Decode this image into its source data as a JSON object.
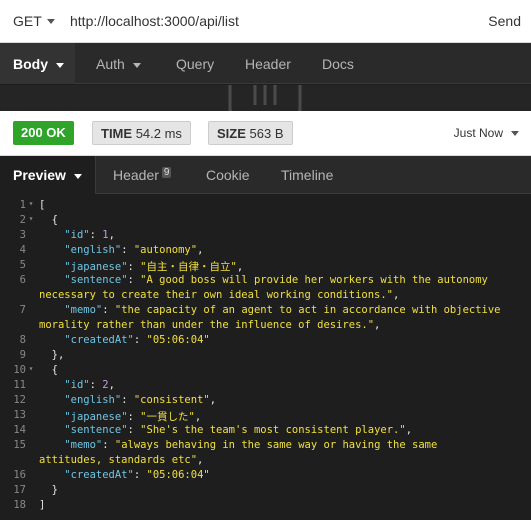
{
  "url_bar": {
    "method": "GET",
    "url": "http://localhost:3000/api/list",
    "send_label": "Send"
  },
  "request_tabs": [
    {
      "label": "Body",
      "active": true
    },
    {
      "label": "Auth",
      "active": false
    },
    {
      "label": "Query",
      "active": false
    },
    {
      "label": "Header",
      "active": false
    },
    {
      "label": "Docs",
      "active": false
    }
  ],
  "status": {
    "code_text": "200 OK",
    "time_label": "TIME",
    "time_value": "54.2 ms",
    "size_label": "SIZE",
    "size_value": "563 B",
    "history_label": "Just Now"
  },
  "response_tabs": [
    {
      "label": "Preview",
      "active": true
    },
    {
      "label": "Header",
      "count": "9",
      "active": false
    },
    {
      "label": "Cookie",
      "active": false
    },
    {
      "label": "Timeline",
      "active": false
    }
  ],
  "code": {
    "line_numbers": [
      "1",
      "2",
      "3",
      "4",
      "5",
      "6",
      "7",
      "8",
      "9",
      "10",
      "11",
      "12",
      "13",
      "14",
      "15",
      "16",
      "17",
      "18"
    ],
    "items": [
      {
        "id": "1",
        "english": "\"autonomy\"",
        "japanese": "\"自主・自律・自立\"",
        "sentence_a": "\"A good boss will provide her workers with the autonomy",
        "sentence_b": "necessary to create their own ideal working conditions.\"",
        "memo_a": "\"the capacity of an agent to act in accordance with objective",
        "memo_b": "morality rather than under the influence of desires.\"",
        "createdAt": "\"05:06:04\""
      },
      {
        "id": "2",
        "english": "\"consistent\"",
        "japanese": "\"一貫した\"",
        "sentence_a": "\"She's the team's most consistent player.\"",
        "memo_a": "\"always behaving in the same way or having the same",
        "memo_b": "attitudes, standards etc\"",
        "createdAt": "\"05:06:04\""
      }
    ],
    "keys": {
      "id": "\"id\"",
      "english": "\"english\"",
      "japanese": "\"japanese\"",
      "sentence": "\"sentence\"",
      "memo": "\"memo\"",
      "createdAt": "\"createdAt\""
    }
  },
  "colors": {
    "key": "#6ec6e6",
    "string": "#f0e040",
    "number": "#c29ae6",
    "status_ok": "#2ea428"
  }
}
